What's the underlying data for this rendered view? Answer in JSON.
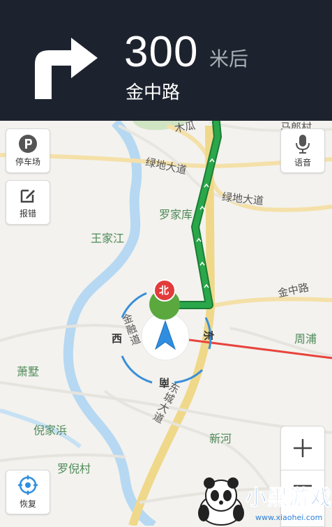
{
  "navigation": {
    "maneuver_icon": "turn-right-arrow-icon",
    "distance": "300",
    "distance_unit": "米后",
    "next_road": "金中路"
  },
  "buttons": {
    "parking": {
      "label": "停车场",
      "icon": "parking-icon"
    },
    "report_error": {
      "label": "报错",
      "icon": "edit-icon"
    },
    "voice": {
      "label": "语音",
      "icon": "microphone-icon"
    },
    "restore": {
      "label": "恢复",
      "icon": "location-target-icon"
    },
    "zoom_in": {
      "icon": "plus-icon"
    },
    "zoom_out": {
      "icon": "minus-icon"
    }
  },
  "map": {
    "place_labels": [
      "王家江",
      "罗家库",
      "周浦",
      "萧墅",
      "倪家浜",
      "罗倪村",
      "新河"
    ],
    "road_labels": {
      "lvdi_1": "绿地大道",
      "lvdi_2": "绿地大道",
      "jinzhong": "金中路",
      "top_left": "木瓜",
      "top_right": "马郎村",
      "jinqiao": "金融道",
      "dongcheng": "东城大道"
    },
    "compass": {
      "north": "北",
      "south": "南",
      "east": "东",
      "west": "西"
    }
  },
  "watermark": {
    "brand": "小黑游戏",
    "url": "www.xiaohei.com"
  },
  "colors": {
    "banner_bg": "#1d232e",
    "route_green": "#2aa74a",
    "heading_line": "#e8433d",
    "position_arrow": "#2f8ee0",
    "compass_ring": "#3a8fd8",
    "north_marker": "#e23b3b"
  }
}
